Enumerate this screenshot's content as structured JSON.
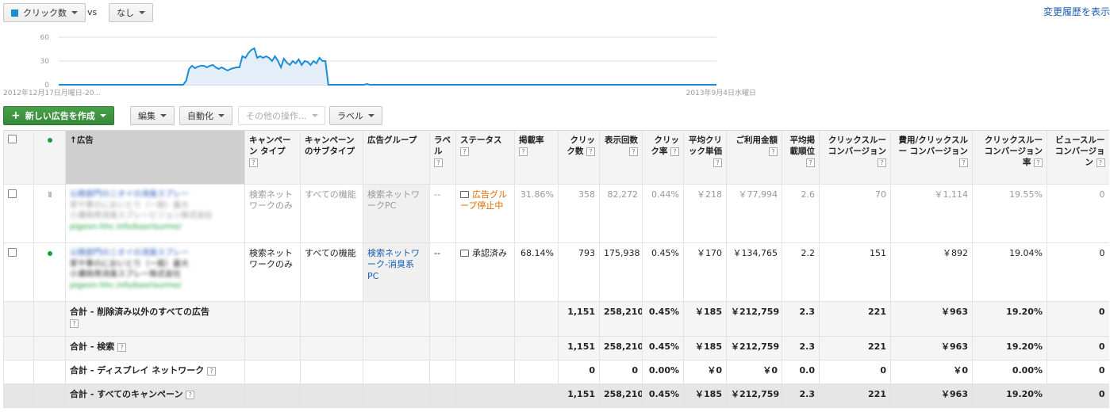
{
  "toolbar_top": {
    "metric1": "クリック数",
    "vs": "vs",
    "metric2": "なし",
    "history_link": "変更履歴を表示"
  },
  "colors": {
    "accent": "#1b8ed3",
    "green": "#37893a",
    "link": "#1a5db0",
    "warning": "#e06c00"
  },
  "chart_data": {
    "type": "area",
    "series": [
      {
        "name": "クリック数",
        "values": [
          0,
          0,
          0,
          0,
          0,
          0,
          0,
          0,
          0,
          0,
          0,
          0,
          0,
          0,
          0,
          0,
          0,
          0,
          0,
          0,
          0,
          0,
          0,
          0,
          0,
          0,
          0,
          0,
          0,
          0,
          0,
          0,
          0,
          0,
          0,
          0,
          0,
          0,
          0,
          0,
          0,
          0,
          0,
          5,
          20,
          24,
          21,
          23,
          24,
          24,
          22,
          24,
          25,
          22,
          20,
          22,
          20,
          18,
          20,
          21,
          22,
          22,
          36,
          34,
          40,
          44,
          46,
          34,
          36,
          34,
          36,
          34,
          30,
          36,
          30,
          22,
          33,
          28,
          25,
          30,
          27,
          32,
          25,
          30,
          29,
          25,
          30,
          27,
          34,
          30,
          30,
          0,
          0,
          0,
          0,
          0,
          0,
          0,
          0,
          0,
          0,
          0,
          0,
          0,
          1,
          0,
          0,
          0,
          0,
          0,
          0,
          0,
          0,
          0,
          0,
          0,
          0,
          0,
          0,
          0,
          0,
          0,
          0,
          0,
          0,
          0,
          0,
          0,
          0,
          0,
          0,
          0,
          0,
          0,
          0,
          0,
          0,
          0,
          0,
          0,
          0,
          0,
          0,
          0,
          0,
          0,
          0,
          0,
          0,
          0,
          0,
          0,
          0,
          0,
          0,
          0,
          0,
          0,
          0,
          0,
          0,
          0,
          0,
          0,
          0,
          0,
          0,
          0,
          0,
          0,
          0,
          0,
          0,
          0,
          0,
          0,
          0,
          0,
          0,
          0,
          0,
          0,
          0,
          0,
          0,
          0,
          0,
          0,
          0,
          0,
          0,
          0,
          0,
          0,
          0,
          0,
          0,
          0,
          0,
          0,
          0,
          0,
          0,
          0,
          0,
          0,
          0,
          0,
          0,
          0,
          0,
          0,
          0,
          0,
          0,
          0,
          0,
          0,
          0,
          0,
          0,
          0,
          0
        ]
      }
    ],
    "yticks": [
      "0",
      "30",
      "60"
    ],
    "ylim": [
      0,
      60
    ],
    "x_start_label": "2012年12月17日月曜日-20...",
    "x_end_label": "2013年9月4日水曜日",
    "grid": true
  },
  "toolbar": {
    "new_ad": "新しい広告を作成",
    "edit": "編集",
    "automate": "自動化",
    "more_actions": "その他の操作...",
    "labels": "ラベル"
  },
  "columns": {
    "ad": "広告",
    "campaign_type": "キャンペーン タイプ",
    "campaign_subtype": "キャンペーンのサブタイプ",
    "ad_group": "広告グループ",
    "label": "ラベル",
    "status": "ステータス",
    "approval_rate": "掲載率",
    "clicks": "クリック数",
    "impressions": "表示回数",
    "ctr": "クリック率",
    "avg_cpc": "平均クリック単価",
    "cost": "ご利用金額",
    "avg_pos": "平均掲載順位",
    "conv": "クリックスルー コンバージョン",
    "cost_per_conv": "費用/クリックスルー コンバージョン",
    "conv_rate": "クリックスルー コンバージョン率",
    "view_conv": "ビュースルー コンバージョン"
  },
  "rows": [
    {
      "ad_lines": [
        "公務部門のニオイの消臭スプレー",
        "家や車のにおいとり（一般）最大",
        "小瀬商用消臭スプレービジョン株式会社",
        "pigeon-hhc.info/kaorisurme/"
      ],
      "campaign_type": "検索ネットワークのみ",
      "campaign_subtype": "すべての機能",
      "ad_group": "検索ネットワークPC",
      "label": "--",
      "status": "広告グループ停止中",
      "approval_rate": "31.86%",
      "clicks": "358",
      "impressions": "82,272",
      "ctr": "0.44%",
      "avg_cpc": "￥218",
      "cost": "￥77,994",
      "avg_pos": "2.6",
      "conv": "70",
      "cost_per_conv": "￥1,114",
      "conv_rate": "19.55%",
      "view_conv": "0"
    },
    {
      "ad_lines": [
        "公務部門のニオイの消臭スプレー",
        "家や車のにおいとり（一般）最大",
        "小瀬商用消臭スプレー株式会社",
        "pigeon-hhc.info/kaorisurme/"
      ],
      "campaign_type": "検索ネットワークのみ",
      "campaign_subtype": "すべての機能",
      "ad_group": "検索ネットワーク-消臭系PC",
      "label": "--",
      "status": "承認済み",
      "approval_rate": "68.14%",
      "clicks": "793",
      "impressions": "175,938",
      "ctr": "0.45%",
      "avg_cpc": "￥170",
      "cost": "￥134,765",
      "avg_pos": "2.2",
      "conv": "151",
      "cost_per_conv": "￥892",
      "conv_rate": "19.04%",
      "view_conv": "0"
    }
  ],
  "totals": [
    {
      "label": "合計 - 削除済み以外のすべての広告",
      "clicks": "1,151",
      "impressions": "258,210",
      "ctr": "0.45%",
      "avg_cpc": "￥185",
      "cost": "￥212,759",
      "avg_pos": "2.3",
      "conv": "221",
      "cost_per_conv": "￥963",
      "conv_rate": "19.20%",
      "view_conv": "0"
    },
    {
      "label": "合計 - 検索",
      "clicks": "1,151",
      "impressions": "258,210",
      "ctr": "0.45%",
      "avg_cpc": "￥185",
      "cost": "￥212,759",
      "avg_pos": "2.3",
      "conv": "221",
      "cost_per_conv": "￥963",
      "conv_rate": "19.20%",
      "view_conv": "0"
    },
    {
      "label": "合計 - ディスプレイ ネットワーク",
      "clicks": "0",
      "impressions": "0",
      "ctr": "0.00%",
      "avg_cpc": "￥0",
      "cost": "￥0",
      "avg_pos": "0.0",
      "conv": "0",
      "cost_per_conv": "￥0",
      "conv_rate": "0.00%",
      "view_conv": "0"
    },
    {
      "label": "合計 - すべてのキャンペーン",
      "clicks": "1,151",
      "impressions": "258,210",
      "ctr": "0.45%",
      "avg_cpc": "￥185",
      "cost": "￥212,759",
      "avg_pos": "2.3",
      "conv": "221",
      "cost_per_conv": "￥963",
      "conv_rate": "19.20%",
      "view_conv": "0"
    }
  ],
  "help_glyph": "?",
  "sort_arrow": "↑"
}
